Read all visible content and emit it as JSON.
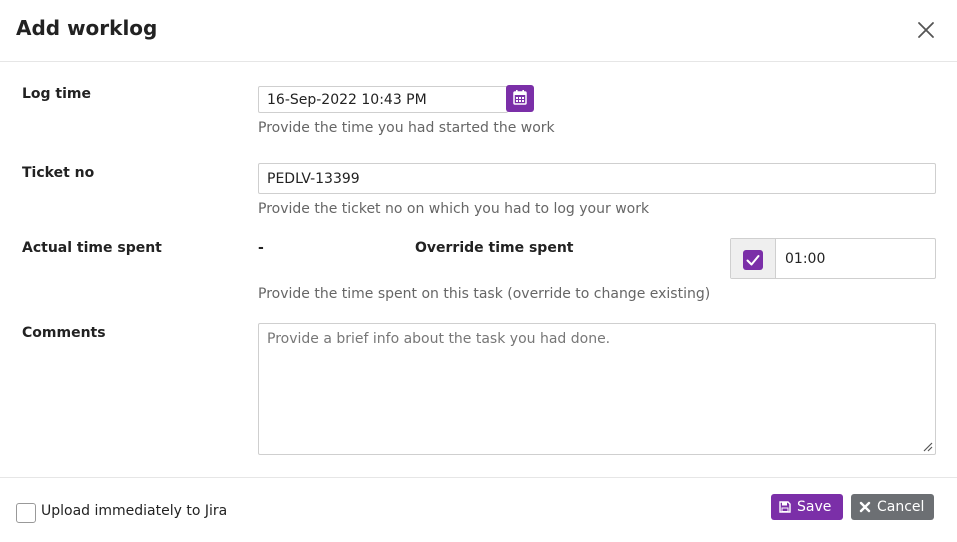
{
  "dialog": {
    "title": "Add worklog"
  },
  "log_time": {
    "label": "Log time",
    "value": "16-Sep-2022 10:43 PM",
    "help": "Provide the time you had started the work"
  },
  "ticket": {
    "label": "Ticket no",
    "value": "PEDLV-13399",
    "help": "Provide the ticket no on which you had to log your work"
  },
  "time_spent": {
    "label": "Actual time spent",
    "actual_value": "-",
    "override_label": "Override time spent",
    "override_value": "01:00",
    "override_checked": true,
    "help": "Provide the time spent on this task (override to change existing)"
  },
  "comments": {
    "label": "Comments",
    "placeholder": "Provide a brief info about the task you had done."
  },
  "footer": {
    "upload_label": "Upload immediately to Jira",
    "save_label": "Save",
    "cancel_label": "Cancel"
  },
  "colors": {
    "accent": "#7b2fa8",
    "secondary": "#6c6f73"
  },
  "icons": {
    "close": "close-icon",
    "calendar": "calendar-icon",
    "check": "check-icon",
    "save": "floppy-disk-icon",
    "cancel": "times-icon"
  }
}
